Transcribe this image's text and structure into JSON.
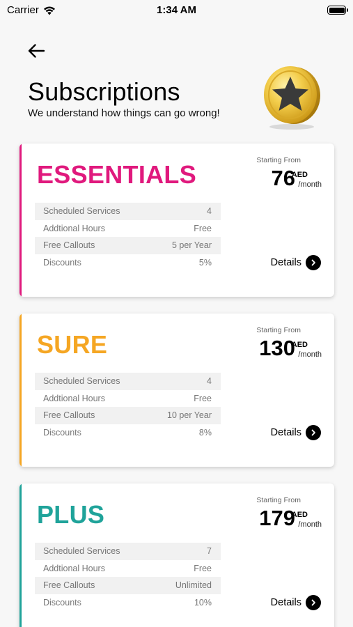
{
  "status_bar": {
    "carrier": "Carrier",
    "time": "1:34 AM"
  },
  "header": {
    "title": "Subscriptions",
    "subtitle": "We understand how things can go wrong!",
    "back_icon": "arrow-left-icon",
    "illustration_icon": "gold-star-coin-icon"
  },
  "plans": [
    {
      "name": "ESSENTIALS",
      "color": "#e0197d",
      "price_label": "Starting From",
      "price": "76",
      "currency": "AED",
      "period": "/month",
      "features": [
        {
          "label": "Scheduled Services",
          "value": "4"
        },
        {
          "label": "Addtional Hours",
          "value": "Free"
        },
        {
          "label": "Free Callouts",
          "value": "5 per Year"
        },
        {
          "label": "Discounts",
          "value": "5%"
        }
      ],
      "details_label": "Details"
    },
    {
      "name": "SURE",
      "color": "#f5a623",
      "price_label": "Starting From",
      "price": "130",
      "currency": "AED",
      "period": "/month",
      "features": [
        {
          "label": "Scheduled Services",
          "value": "4"
        },
        {
          "label": "Addtional Hours",
          "value": "Free"
        },
        {
          "label": "Free Callouts",
          "value": "10 per Year"
        },
        {
          "label": "Discounts",
          "value": "8%"
        }
      ],
      "details_label": "Details"
    },
    {
      "name": "PLUS",
      "color": "#1fa39a",
      "price_label": "Starting From",
      "price": "179",
      "currency": "AED",
      "period": "/month",
      "features": [
        {
          "label": "Scheduled Services",
          "value": "7"
        },
        {
          "label": "Addtional Hours",
          "value": "Free"
        },
        {
          "label": "Free Callouts",
          "value": "Unlimited"
        },
        {
          "label": "Discounts",
          "value": "10%"
        }
      ],
      "details_label": "Details"
    }
  ]
}
